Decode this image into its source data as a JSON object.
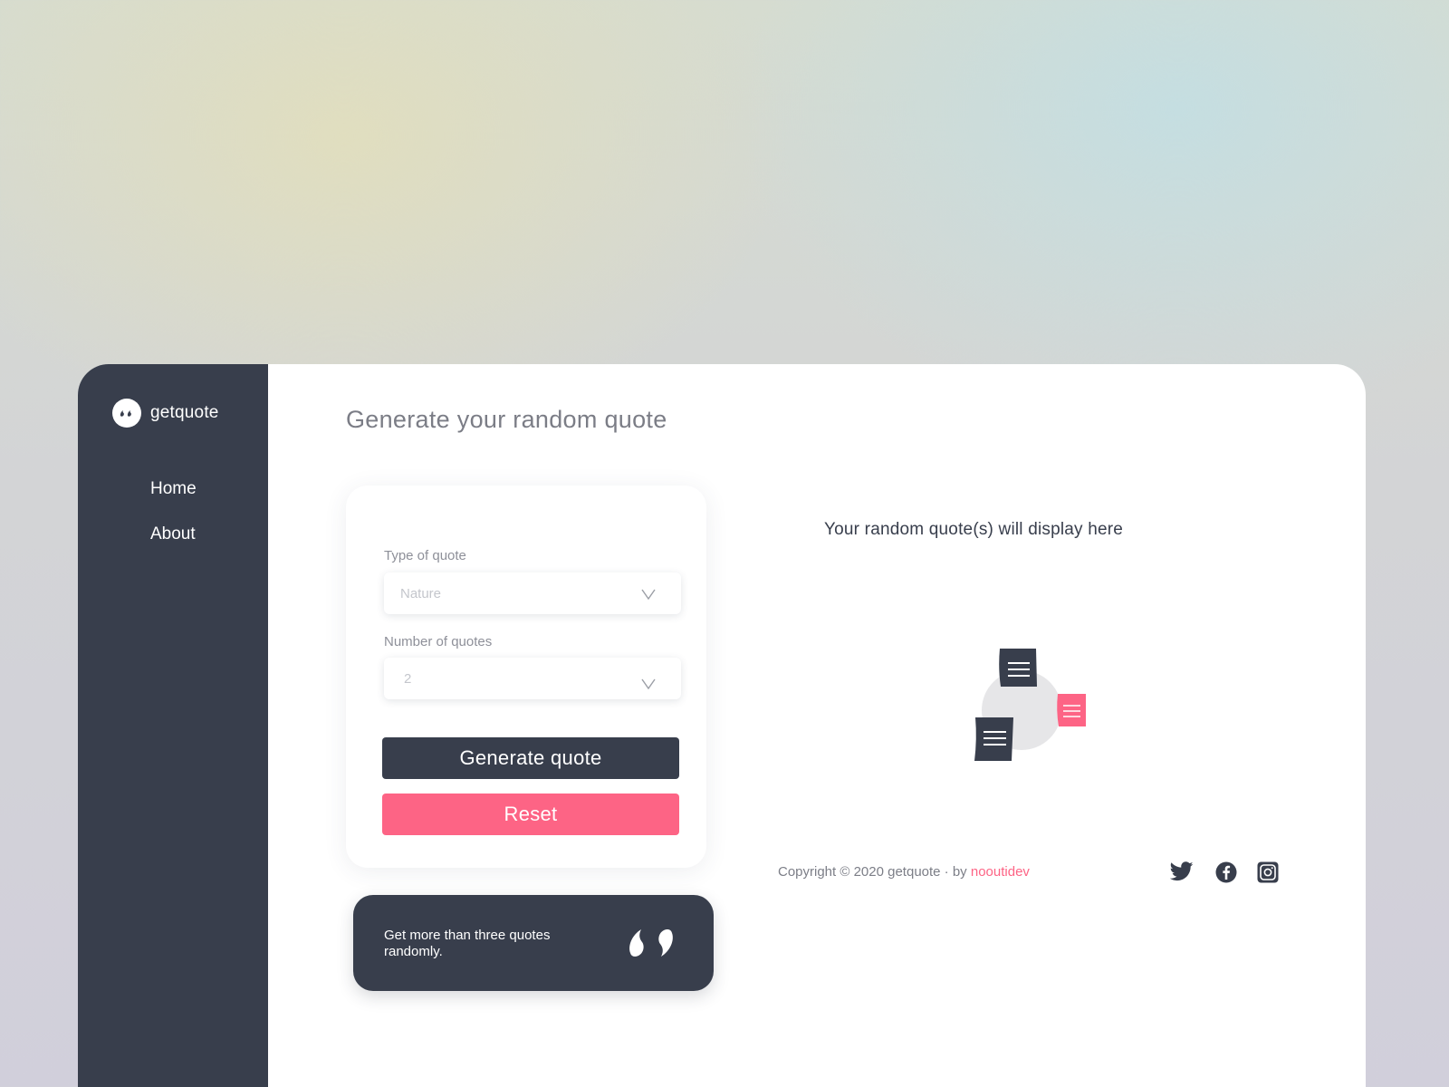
{
  "brand": {
    "name": "getquote",
    "logo_icon": "quote-marks-icon"
  },
  "nav": {
    "items": [
      {
        "label": "Home"
      },
      {
        "label": "About"
      }
    ]
  },
  "main": {
    "title": "Generate your random quote"
  },
  "form": {
    "type_label": "Type of quote",
    "type_value": "Nature",
    "count_label": "Number of quotes",
    "count_value": "2",
    "generate_label": "Generate quote",
    "reset_label": "Reset"
  },
  "promo": {
    "text": "Get more than three quotes randomly.",
    "icon": "quote-marks-icon"
  },
  "display": {
    "placeholder": "Your random quote(s) will display here"
  },
  "footer": {
    "copyright": "Copyright © 2020 getquote · by ",
    "author": "nooutidev",
    "social": [
      "twitter-icon",
      "facebook-icon",
      "instagram-icon"
    ]
  },
  "colors": {
    "sidebar": "#383e4c",
    "accent": "#fd6485",
    "card": "#ffffff",
    "muted_text": "#7b7d86"
  }
}
